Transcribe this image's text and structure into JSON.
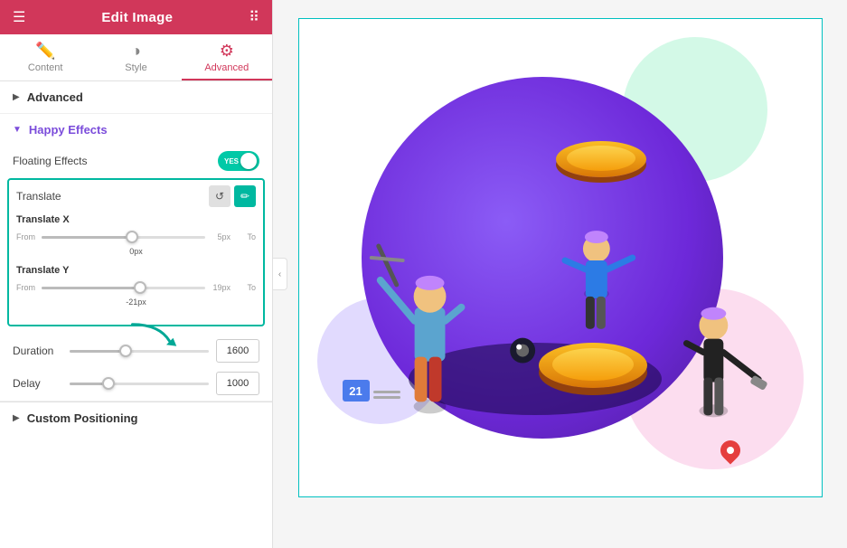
{
  "header": {
    "title": "Edit Image",
    "hamburger": "☰",
    "grid": "⠿"
  },
  "tabs": [
    {
      "id": "content",
      "label": "Content",
      "icon": "✏️",
      "active": false
    },
    {
      "id": "style",
      "label": "Style",
      "icon": "◑",
      "active": false
    },
    {
      "id": "advanced",
      "label": "Advanced",
      "icon": "⚙",
      "active": true
    }
  ],
  "sections": {
    "advanced": {
      "label": "Advanced",
      "collapsed": true
    },
    "happy_effects": {
      "label": "Happy Effects",
      "collapsed": false
    }
  },
  "floating_effects": {
    "label": "Floating Effects",
    "toggle_text": "YES",
    "enabled": true
  },
  "translate": {
    "label": "Translate",
    "translate_x": {
      "label": "Translate X",
      "from_label": "From",
      "to_label": "To",
      "value": "5px",
      "current": "0px",
      "thumb_pct": 55
    },
    "translate_y": {
      "label": "Translate Y",
      "from_label": "From",
      "to_label": "To",
      "value": "19px",
      "current": "-21px",
      "thumb_pct": 60
    }
  },
  "duration": {
    "label": "Duration",
    "value": "1600",
    "thumb_pct": 40
  },
  "delay": {
    "label": "Delay",
    "value": "1000",
    "thumb_pct": 28
  },
  "custom_positioning": {
    "label": "Custom Positioning"
  },
  "canvas": {
    "badge_number": "21"
  }
}
